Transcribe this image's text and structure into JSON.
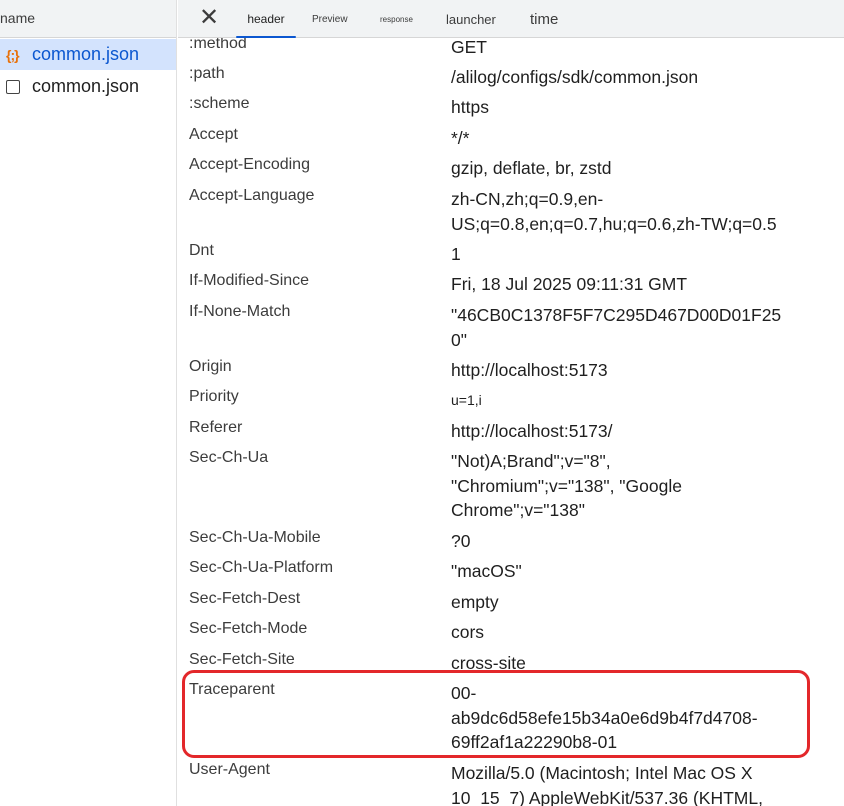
{
  "sidebar": {
    "column_label": "name",
    "requests": [
      {
        "label": "common.json",
        "icon": "json-braces-icon"
      },
      {
        "label": "common.json",
        "icon": "document-icon"
      }
    ]
  },
  "tabs": {
    "close_icon": "close-icon",
    "items": [
      {
        "label": "header"
      },
      {
        "label": "Preview"
      },
      {
        "label": "response"
      },
      {
        "label": "launcher"
      },
      {
        "label": "time"
      }
    ]
  },
  "headers": [
    {
      "name": ":method",
      "value": "GET"
    },
    {
      "name": ":path",
      "value": "/alilog/configs/sdk/common.json"
    },
    {
      "name": ":scheme",
      "value": "https"
    },
    {
      "name": "Accept",
      "value": "*/*"
    },
    {
      "name": "Accept-Encoding",
      "value": "gzip, deflate, br, zstd"
    },
    {
      "name": "Accept-Language",
      "value": "zh-CN,zh;q=0.9,en-\nUS;q=0.8,en;q=0.7,hu;q=0.6,zh-TW;q=0.5"
    },
    {
      "name": "Dnt",
      "value": "1"
    },
    {
      "name": "If-Modified-Since",
      "value": "Fri, 18 Jul 2025 09:11:31 GMT"
    },
    {
      "name": "If-None-Match",
      "value": "\"46CB0C1378F5F7C295D467D00D01F25\n0\""
    },
    {
      "name": "Origin",
      "value": "http://localhost:5173"
    },
    {
      "name": "Priority",
      "value": "u=1,i"
    },
    {
      "name": "Referer",
      "value": "http://localhost:5173/"
    },
    {
      "name": "Sec-Ch-Ua",
      "value": "\"Not)A;Brand\";v=\"8\",\n\"Chromium\";v=\"138\", \"Google\nChrome\";v=\"138\""
    },
    {
      "name": "Sec-Ch-Ua-Mobile",
      "value": "?0"
    },
    {
      "name": "Sec-Ch-Ua-Platform",
      "value": "\"macOS\""
    },
    {
      "name": "Sec-Fetch-Dest",
      "value": "empty"
    },
    {
      "name": "Sec-Fetch-Mode",
      "value": "cors"
    },
    {
      "name": "Sec-Fetch-Site",
      "value": "cross-site"
    },
    {
      "name": "Traceparent",
      "value": "00-\nab9dc6d58efe15b34a0e6d9b4f7d4708-\n69ff2af1a22290b8-01"
    },
    {
      "name": "User-Agent",
      "value": "Mozilla/5.0 (Macintosh; Intel Mac OS X\n10_15_7) AppleWebKit/537.36 (KHTML,"
    }
  ],
  "highlight_color": "#e3272a"
}
